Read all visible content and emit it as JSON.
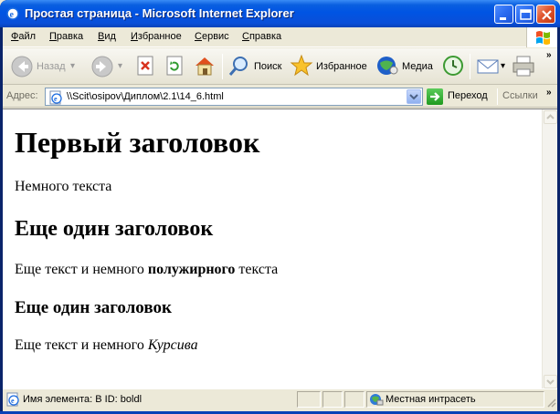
{
  "window": {
    "title": "Простая страница - Microsoft Internet Explorer"
  },
  "menu": {
    "items": [
      {
        "label": "Файл",
        "accel": "Ф",
        "rest": "айл"
      },
      {
        "label": "Правка",
        "accel": "П",
        "rest": "равка"
      },
      {
        "label": "Вид",
        "accel": "В",
        "rest": "ид"
      },
      {
        "label": "Избранное",
        "accel": "И",
        "rest": "збранное"
      },
      {
        "label": "Сервис",
        "accel": "С",
        "rest": "ервис"
      },
      {
        "label": "Справка",
        "accel": "С",
        "rest": "правка"
      }
    ]
  },
  "toolbar": {
    "back_label": "Назад",
    "search_label": "Поиск",
    "favorites_label": "Избранное",
    "media_label": "Медиа"
  },
  "address": {
    "label": "Адрес:",
    "value": "\\\\Scit\\osipov\\Диплом\\2.1\\14_6.html",
    "go_label": "Переход",
    "links_label": "Ссылки"
  },
  "page": {
    "h1": "Первый заголовок",
    "p1": "Немного текста",
    "h2": "Еще один заголовок",
    "p2_before": "Еще текст и немного ",
    "p2_bold": "полужирного",
    "p2_after": " текста",
    "h3": "Еще один заголовок",
    "p3_before": "Еще текст и немного ",
    "p3_italic": "Курсива"
  },
  "status": {
    "element_text": "Имя элемента: B ID: boldl",
    "zone_text": "Местная интрасеть"
  },
  "colors": {
    "titlebar": "#0054E3",
    "chrome": "#ECE9D8"
  }
}
